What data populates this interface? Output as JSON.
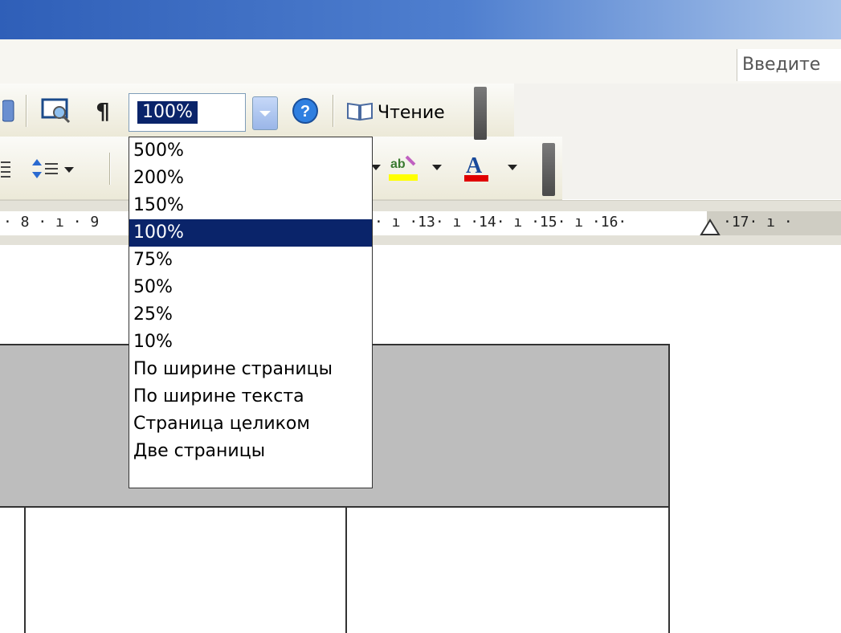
{
  "help": {
    "placeholder": "Введите"
  },
  "toolbar": {
    "zoom_value": "100%",
    "reading_label": "Чтение",
    "icons": [
      "research-icon",
      "preview-icon",
      "pilcrow-icon",
      "help-icon",
      "book-icon",
      "line-spacing-icon",
      "highlight-icon",
      "font-color-icon"
    ]
  },
  "ruler": {
    "left_text": "· 8 · ı · 9",
    "right_text": "· ı ·13· ı ·14· ı ·15· ı ·16·",
    "right_grey_text": "·17· ı ·"
  },
  "zoom_dropdown": {
    "selected": "100%",
    "options": [
      "500%",
      "200%",
      "150%",
      "100%",
      "75%",
      "50%",
      "25%",
      "10%",
      "По ширине страницы",
      "По ширине текста",
      "Страница целиком",
      "Две страницы"
    ]
  },
  "colors": {
    "selection": "#0a246a",
    "titlebar": "#2f5fb8",
    "highlight": "#ffff00",
    "font_color": "#e00000"
  }
}
